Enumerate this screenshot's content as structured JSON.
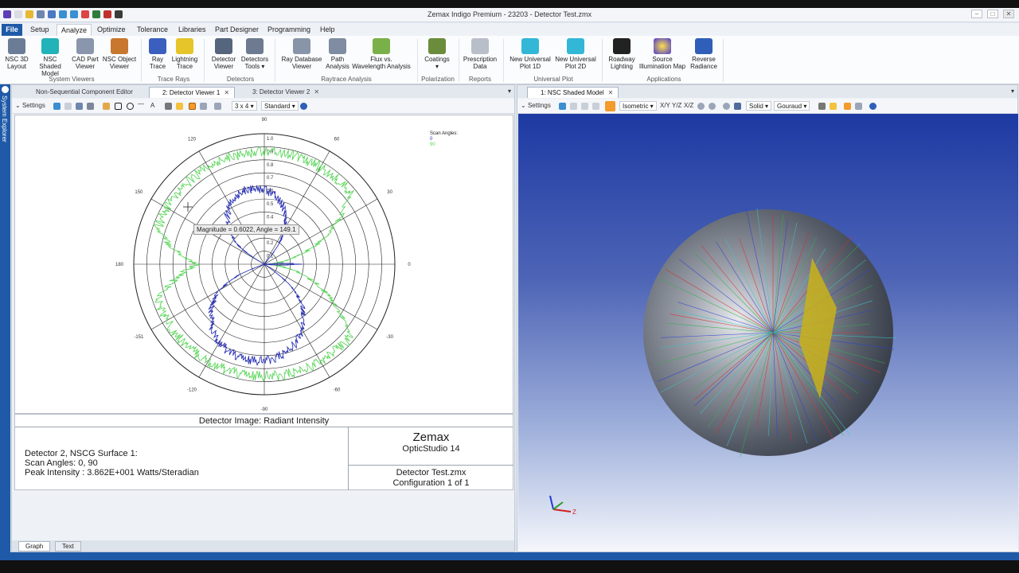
{
  "window": {
    "title": "Zemax Indigo Premium - 23203 - Detector Test.zmx"
  },
  "menu_tabs": [
    "File",
    "Setup",
    "Analyze",
    "Optimize",
    "Tolerance",
    "Libraries",
    "Part Designer",
    "Programming",
    "Help"
  ],
  "ribbon": {
    "buttons": [
      {
        "label1": "NSC 3D",
        "label2": "Layout",
        "icon": "nsc-3d-layout-icon",
        "color": "#6b7d96"
      },
      {
        "label1": "NSC Shaded",
        "label2": "Model",
        "icon": "nsc-shaded-model-icon",
        "color": "#21b3b8"
      },
      {
        "label1": "CAD Part",
        "label2": "Viewer",
        "icon": "cad-part-viewer-icon",
        "color": "#8a96ab"
      },
      {
        "label1": "NSC Object",
        "label2": "Viewer",
        "icon": "nsc-object-viewer-icon",
        "color": "#c8772f"
      },
      {
        "label1": "Ray",
        "label2": "Trace",
        "icon": "ray-trace-icon",
        "color": "#3a5fbf"
      },
      {
        "label1": "Lightning",
        "label2": "Trace",
        "icon": "lightning-trace-icon",
        "color": "#e5c52a"
      },
      {
        "label1": "Detector",
        "label2": "Viewer",
        "icon": "detector-viewer-icon",
        "color": "#55657d"
      },
      {
        "label1": "Detectors",
        "label2": "Tools ▾",
        "icon": "detectors-tools-icon",
        "color": "#6d7a8f"
      },
      {
        "label1": "Ray Database",
        "label2": "Viewer",
        "icon": "ray-database-viewer-icon",
        "color": "#8895a9"
      },
      {
        "label1": "Path",
        "label2": "Analysis",
        "icon": "path-analysis-icon",
        "color": "#7f8ca1"
      },
      {
        "label1": "Flux vs.",
        "label2": "Wavelength Analysis",
        "icon": "flux-wavelength-icon",
        "color": "#7ab04a"
      },
      {
        "label1": "Coatings",
        "label2": "▾",
        "icon": "coatings-icon",
        "color": "#6b8c3a"
      },
      {
        "label1": "Prescription",
        "label2": "Data",
        "icon": "prescription-data-icon",
        "color": "#b9bfc9"
      },
      {
        "label1": "New Universal",
        "label2": "Plot 1D",
        "icon": "universal-plot-1d-icon",
        "color": "#32b7d6"
      },
      {
        "label1": "New Universal",
        "label2": "Plot 2D",
        "icon": "universal-plot-2d-icon",
        "color": "#32b7d6"
      },
      {
        "label1": "Roadway",
        "label2": "Lighting",
        "icon": "roadway-lighting-icon",
        "color": "#222222"
      },
      {
        "label1": "Source",
        "label2": "Illumination Map",
        "icon": "source-illumination-map-icon",
        "color": "#4a38d1"
      },
      {
        "label1": "Reverse",
        "label2": "Radiance",
        "icon": "reverse-radiance-icon",
        "color": "#2f5fb8"
      }
    ],
    "groups": [
      "System Viewers",
      "Trace Rays",
      "Detectors",
      "Raytrace Analysis",
      "Polarization",
      "Reports",
      "Universal Plot",
      "Applications"
    ]
  },
  "left_strip": {
    "label": "System Explorer"
  },
  "left_pane": {
    "tabs": [
      {
        "label": "Non-Sequential Component Editor"
      },
      {
        "label": "2: Detector Viewer 1"
      },
      {
        "label": "3: Detector Viewer 2"
      }
    ],
    "toolbar": {
      "settings": "Settings",
      "layout": "3 x 4",
      "mode": "Standard"
    },
    "plot": {
      "tooltip": "Magnitude = 0.6022, Angle = 149.1",
      "legend_title": "Scan Angles:",
      "legend_items": [
        {
          "label": "0",
          "color": "#2b33b5"
        },
        {
          "label": "90",
          "color": "#5cd65c"
        }
      ],
      "radial_labels": [
        "0.1",
        "0.2",
        "0.3",
        "0.4",
        "0.5",
        "0.6",
        "0.7",
        "0.8",
        "0.9",
        "1.0"
      ],
      "angle_labels": [
        {
          "deg": 0,
          "text": "0"
        },
        {
          "deg": 30,
          "text": "30"
        },
        {
          "deg": 60,
          "text": "60"
        },
        {
          "deg": 90,
          "text": "90"
        },
        {
          "deg": 120,
          "text": "120"
        },
        {
          "deg": 150,
          "text": "150"
        },
        {
          "deg": 180,
          "text": "180"
        },
        {
          "deg": 210,
          "text": "-151"
        },
        {
          "deg": 240,
          "text": "-120"
        },
        {
          "deg": 270,
          "text": "-90"
        },
        {
          "deg": 300,
          "text": "-60"
        },
        {
          "deg": 330,
          "text": "-30"
        }
      ]
    },
    "footer": {
      "caption": "Detector Image: Radiant Intensity",
      "line1": "Detector 2, NSCG Surface 1:",
      "line2": "Scan Angles: 0, 90",
      "line3": "Peak Intensity  : 3.862E+001 Watts/Steradian",
      "brand": "Zemax",
      "product": "OpticStudio 14",
      "file": "Detector Test.zmx",
      "config": "Configuration 1 of 1"
    },
    "bottom_tabs": [
      "Graph",
      "Text"
    ]
  },
  "right_pane": {
    "tab": "1: NSC Shaded Model",
    "toolbar": {
      "settings": "Settings",
      "view": "Isometric",
      "xy": "X/Y",
      "yz": "Y/Z",
      "xz": "X/Z",
      "render": "Solid",
      "shading": "Gouraud"
    },
    "axis_label": "Z"
  }
}
